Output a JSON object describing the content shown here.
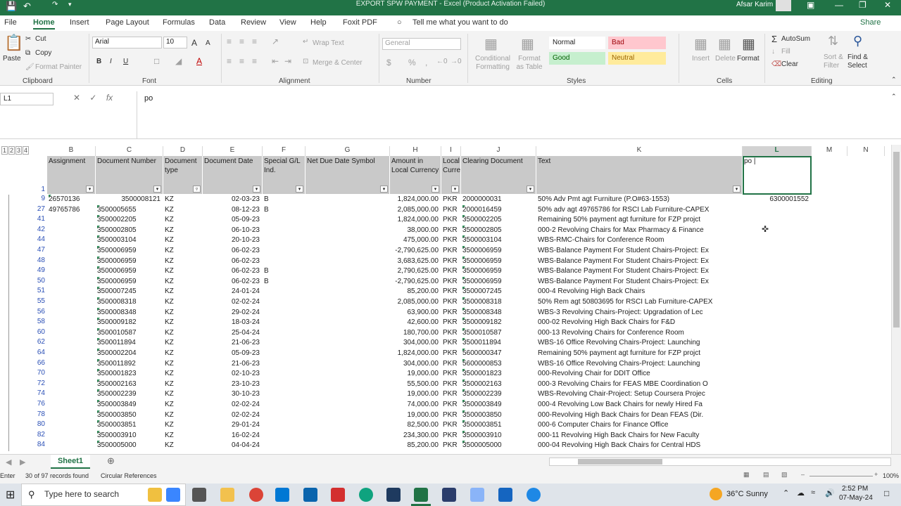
{
  "title": "EXPORT SPW PAYMENT - Excel (Product Activation Failed)",
  "user": "Afsar Karim",
  "tabs": [
    "File",
    "Home",
    "Insert",
    "Page Layout",
    "Formulas",
    "Data",
    "Review",
    "View",
    "Help",
    "Foxit PDF"
  ],
  "tell_me": "Tell me what you want to do",
  "share": "Share",
  "clipboard": {
    "paste": "Paste",
    "cut": "Cut",
    "copy": "Copy",
    "format_painter": "Format Painter",
    "label": "Clipboard"
  },
  "font": {
    "name": "Arial",
    "size": "10",
    "label": "Font",
    "bold": "B",
    "italic": "I",
    "underline": "U",
    "grow": "A",
    "shrink": "A"
  },
  "alignment": {
    "wrap": "Wrap Text",
    "merge": "Merge & Center",
    "label": "Alignment"
  },
  "number": {
    "format": "General",
    "label": "Number",
    "currency": "$",
    "percent": "%",
    "comma": ","
  },
  "styles": {
    "conditional": "Conditional Formatting",
    "format_as": "Format as Table",
    "normal": "Normal",
    "bad": "Bad",
    "good": "Good",
    "neutral": "Neutral",
    "label": "Styles"
  },
  "cells": {
    "insert": "Insert",
    "delete": "Delete",
    "format": "Format",
    "label": "Cells"
  },
  "editing": {
    "autosum": "AutoSum",
    "fill": "Fill",
    "clear": "Clear",
    "sort": "Sort & Filter",
    "find": "Find & Select",
    "label": "Editing"
  },
  "namebox": "L1",
  "formula": "po",
  "outline_levels": [
    "1",
    "2",
    "3",
    "4"
  ],
  "columns": [
    "B",
    "C",
    "D",
    "E",
    "F",
    "G",
    "H",
    "I",
    "J",
    "K",
    "L",
    "M",
    "N"
  ],
  "headers": {
    "B": "Assignment",
    "C": "Document Number",
    "D": "Document type",
    "E": "Document Date",
    "F": "Special G/L Ind.",
    "G": "Net Due Date Symbol",
    "H": "Amount in Local Currency",
    "I": "Local Curren",
    "J": "Clearing Document",
    "K": "Text",
    "L": "po |"
  },
  "header_rownum": "1",
  "rows": [
    {
      "n": "9",
      "B": "26570136",
      "C": "3500008121",
      "D": "KZ",
      "E": "02-03-23",
      "F": "B",
      "H": "1,824,000.00",
      "I": "PKR",
      "J": "2000000031",
      "K": "50% Adv Pmt agt Furniture (P.O#63-1553)",
      "L": "6300001552"
    },
    {
      "n": "27",
      "B": "49765786",
      "C": "3500005655",
      "D": "KZ",
      "E": "08-12-23",
      "F": "B",
      "H": "2,085,000.00",
      "I": "PKR",
      "J": "2000016459",
      "K": "50% adv agt 49765786 for RSCI Lab Furniture-CAPEX",
      "L": ""
    },
    {
      "n": "41",
      "B": "",
      "C": "3500002205",
      "D": "KZ",
      "E": "05-09-23",
      "F": "",
      "H": "1,824,000.00",
      "I": "PKR",
      "J": "3500002205",
      "K": "Remaining 50% payment agt furniture for FZP projct",
      "L": ""
    },
    {
      "n": "42",
      "B": "",
      "C": "3500002805",
      "D": "KZ",
      "E": "06-10-23",
      "F": "",
      "H": "38,000.00",
      "I": "PKR",
      "J": "3500002805",
      "K": "000-2 Revolving Chairs for Max Pharmacy & Finance",
      "L": ""
    },
    {
      "n": "44",
      "B": "",
      "C": "3500003104",
      "D": "KZ",
      "E": "20-10-23",
      "F": "",
      "H": "475,000.00",
      "I": "PKR",
      "J": "3500003104",
      "K": "WBS-RMC-Chairs for Conference Room",
      "L": ""
    },
    {
      "n": "47",
      "B": "",
      "C": "3500006959",
      "D": "KZ",
      "E": "06-02-23",
      "F": "",
      "H": "-2,790,625.00",
      "I": "PKR",
      "J": "3500006959",
      "K": "WBS-Balance Payment For Student Chairs-Project: Ex",
      "L": ""
    },
    {
      "n": "48",
      "B": "",
      "C": "3500006959",
      "D": "KZ",
      "E": "06-02-23",
      "F": "",
      "H": "3,683,625.00",
      "I": "PKR",
      "J": "3500006959",
      "K": "WBS-Balance Payment For Student Chairs-Project: Ex",
      "L": ""
    },
    {
      "n": "49",
      "B": "",
      "C": "3500006959",
      "D": "KZ",
      "E": "06-02-23",
      "F": "B",
      "H": "2,790,625.00",
      "I": "PKR",
      "J": "3500006959",
      "K": "WBS-Balance Payment For Student Chairs-Project: Ex",
      "L": ""
    },
    {
      "n": "50",
      "B": "",
      "C": "3500006959",
      "D": "KZ",
      "E": "06-02-23",
      "F": "B",
      "H": "-2,790,625.00",
      "I": "PKR",
      "J": "3500006959",
      "K": "WBS-Balance Payment For Student Chairs-Project: Ex",
      "L": ""
    },
    {
      "n": "51",
      "B": "",
      "C": "3500007245",
      "D": "KZ",
      "E": "24-01-24",
      "F": "",
      "H": "85,200.00",
      "I": "PKR",
      "J": "3500007245",
      "K": "000-4 Revolving High Back Chairs",
      "L": ""
    },
    {
      "n": "55",
      "B": "",
      "C": "3500008318",
      "D": "KZ",
      "E": "02-02-24",
      "F": "",
      "H": "2,085,000.00",
      "I": "PKR",
      "J": "3500008318",
      "K": "50% Rem agt 50803695 for RSCI Lab Furniture-CAPEX",
      "L": ""
    },
    {
      "n": "56",
      "B": "",
      "C": "3500008348",
      "D": "KZ",
      "E": "29-02-24",
      "F": "",
      "H": "63,900.00",
      "I": "PKR",
      "J": "3500008348",
      "K": "WBS-3 Revolving Chairs-Project: Upgradation of Lec",
      "L": ""
    },
    {
      "n": "58",
      "B": "",
      "C": "3500009182",
      "D": "KZ",
      "E": "18-03-24",
      "F": "",
      "H": "42,600.00",
      "I": "PKR",
      "J": "3500009182",
      "K": "000-02 Revolving High Back Chairs for F&D",
      "L": ""
    },
    {
      "n": "60",
      "B": "",
      "C": "3500010587",
      "D": "KZ",
      "E": "25-04-24",
      "F": "",
      "H": "180,700.00",
      "I": "PKR",
      "J": "3500010587",
      "K": "000-13 Revolving Chairs for Conference Room",
      "L": ""
    },
    {
      "n": "62",
      "B": "",
      "C": "3500011894",
      "D": "KZ",
      "E": "21-06-23",
      "F": "",
      "H": "304,000.00",
      "I": "PKR",
      "J": "3500011894",
      "K": "WBS-16 Office Revolving Chairs-Project: Launching",
      "L": ""
    },
    {
      "n": "64",
      "B": "",
      "C": "3500002204",
      "D": "KZ",
      "E": "05-09-23",
      "F": "",
      "H": "1,824,000.00",
      "I": "PKR",
      "J": "5600000347",
      "K": "Remaining 50% payment agt furniture for FZP projct",
      "L": ""
    },
    {
      "n": "66",
      "B": "",
      "C": "3500011892",
      "D": "KZ",
      "E": "21-06-23",
      "F": "",
      "H": "304,000.00",
      "I": "PKR",
      "J": "5600000853",
      "K": "WBS-16 Office Revolving Chairs-Project: Launching",
      "L": ""
    },
    {
      "n": "70",
      "B": "",
      "C": "3500001823",
      "D": "KZ",
      "E": "02-10-23",
      "F": "",
      "H": "19,000.00",
      "I": "PKR",
      "J": "3500001823",
      "K": "000-Revolving Chair for DDIT Office",
      "L": ""
    },
    {
      "n": "72",
      "B": "",
      "C": "3500002163",
      "D": "KZ",
      "E": "23-10-23",
      "F": "",
      "H": "55,500.00",
      "I": "PKR",
      "J": "3500002163",
      "K": "000-3 Revolving Chairs for FEAS MBE Coordination O",
      "L": ""
    },
    {
      "n": "74",
      "B": "",
      "C": "3500002239",
      "D": "KZ",
      "E": "30-10-23",
      "F": "",
      "H": "19,000.00",
      "I": "PKR",
      "J": "3500002239",
      "K": "WBS-Revolving Chair-Project: Setup Coursera Projec",
      "L": ""
    },
    {
      "n": "76",
      "B": "",
      "C": "3500003849",
      "D": "KZ",
      "E": "02-02-24",
      "F": "",
      "H": "74,000.00",
      "I": "PKR",
      "J": "3500003849",
      "K": "000-4 Revolving Low Back Chairs for newly Hired Fa",
      "L": ""
    },
    {
      "n": "78",
      "B": "",
      "C": "3500003850",
      "D": "KZ",
      "E": "02-02-24",
      "F": "",
      "H": "19,000.00",
      "I": "PKR",
      "J": "3500003850",
      "K": "000-Revolving High Back Chairs for Dean FEAS (Dir.",
      "L": ""
    },
    {
      "n": "80",
      "B": "",
      "C": "3500003851",
      "D": "KZ",
      "E": "29-01-24",
      "F": "",
      "H": "82,500.00",
      "I": "PKR",
      "J": "3500003851",
      "K": "000-6 Computer Chairs for Finance Office",
      "L": ""
    },
    {
      "n": "82",
      "B": "",
      "C": "3500003910",
      "D": "KZ",
      "E": "16-02-24",
      "F": "",
      "H": "234,300.00",
      "I": "PKR",
      "J": "3500003910",
      "K": "000-11 Revolving High Back Chairs for New Faculty",
      "L": ""
    },
    {
      "n": "84",
      "B": "",
      "C": "3500005000",
      "D": "KZ",
      "E": "04-04-24",
      "F": "",
      "H": "85,200.00",
      "I": "PKR",
      "J": "3500005000",
      "K": "000-04 Revolving High Back Chairs for Central HDS",
      "L": ""
    }
  ],
  "sheet_tab": "Sheet1",
  "status": {
    "mode": "Enter",
    "records": "30 of 97 records found",
    "circ": "Circular References",
    "zoom": "100%"
  },
  "taskbar": {
    "search": "Type here to search",
    "weather": "36°C  Sunny",
    "time": "2:52 PM",
    "date": "07-May-24"
  }
}
